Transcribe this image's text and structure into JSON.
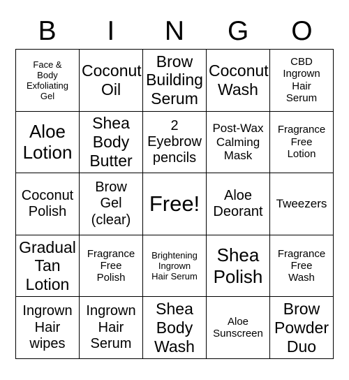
{
  "card": {
    "header_letters": [
      "B",
      "I",
      "N",
      "G",
      "O"
    ],
    "rows": [
      [
        {
          "text": "Face &\nBody\nExfoliating\nGel",
          "size": "xs"
        },
        {
          "text": "Coconut\nOil",
          "size": "xl"
        },
        {
          "text": "Brow\nBuilding\nSerum",
          "size": "xl"
        },
        {
          "text": "Coconut\nWash",
          "size": "xl"
        },
        {
          "text": "CBD\nIngrown\nHair\nSerum",
          "size": "s"
        }
      ],
      [
        {
          "text": "Aloe\nLotion",
          "size": "xxl"
        },
        {
          "text": "Shea\nBody\nButter",
          "size": "xl"
        },
        {
          "text": "2\nEyebrow\npencils",
          "size": "l"
        },
        {
          "text": "Post-Wax\nCalming\nMask",
          "size": "m"
        },
        {
          "text": "Fragrance\nFree\nLotion",
          "size": "s"
        }
      ],
      [
        {
          "text": "Coconut\nPolish",
          "size": "l"
        },
        {
          "text": "Brow\nGel\n(clear)",
          "size": "l"
        },
        {
          "text": "Free!",
          "size": "free"
        },
        {
          "text": "Aloe\nDeorant",
          "size": "l"
        },
        {
          "text": "Tweezers",
          "size": "m"
        }
      ],
      [
        {
          "text": "Gradual\nTan\nLotion",
          "size": "xl"
        },
        {
          "text": "Fragrance\nFree\nPolish",
          "size": "s"
        },
        {
          "text": "Brightening\nIngrown\nHair Serum",
          "size": "xs"
        },
        {
          "text": "Shea\nPolish",
          "size": "xxl"
        },
        {
          "text": "Fragrance\nFree\nWash",
          "size": "s"
        }
      ],
      [
        {
          "text": "Ingrown\nHair\nwipes",
          "size": "l"
        },
        {
          "text": "Ingrown\nHair\nSerum",
          "size": "l"
        },
        {
          "text": "Shea\nBody\nWash",
          "size": "xl"
        },
        {
          "text": "Aloe\nSunscreen",
          "size": "s"
        },
        {
          "text": "Brow\nPowder\nDuo",
          "size": "xl"
        }
      ]
    ]
  }
}
